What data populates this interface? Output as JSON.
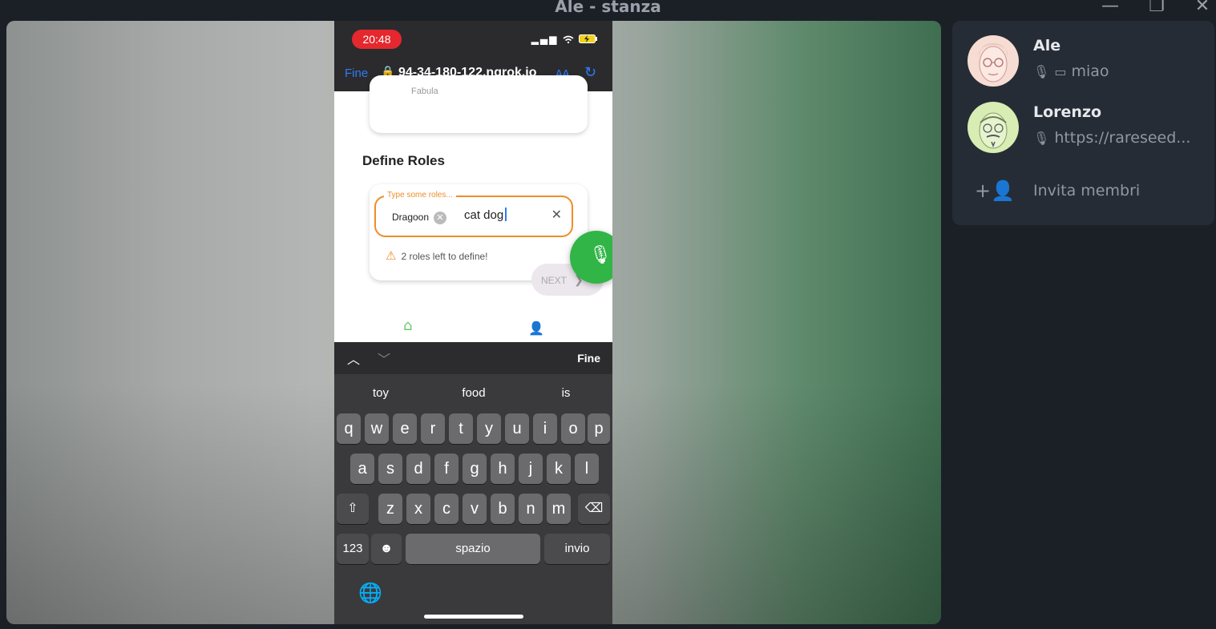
{
  "window": {
    "title": "Ale - stanza",
    "minimize_glyph": "—",
    "restore_glyph": "❐",
    "close_glyph": "✕"
  },
  "phone": {
    "status": {
      "time": "20:48",
      "signal": "▂▄▆",
      "wifi": "wifi-icon",
      "battery": "battery-charging-icon"
    },
    "browser": {
      "done_label": "Fine",
      "url": "94-34-180-122.ngrok.io",
      "text_size_label": "AA",
      "lock_glyph": "🔒",
      "reload_glyph": "↻"
    },
    "page": {
      "top_card_label": "Fabula",
      "section_title": "Define Roles",
      "roles_input_legend": "Type some roles...",
      "chips": [
        {
          "label": "Dragoon",
          "remove_glyph": "✕"
        }
      ],
      "typed_text": "cat dog",
      "clear_glyph": "✕",
      "warning_text": "2 roles left to define!",
      "warning_glyph": "⚠",
      "next_label": "NEXT",
      "next_glyph": "❯",
      "home_glyph": "⌂",
      "person_glyph": "👤",
      "mic_glyph": "🎙"
    },
    "keyboard": {
      "toolbar_up": "︿",
      "toolbar_down": "﹀",
      "toolbar_done": "Fine",
      "suggestions": [
        "toy",
        "food",
        "is"
      ],
      "row1": [
        "q",
        "w",
        "e",
        "r",
        "t",
        "y",
        "u",
        "i",
        "o",
        "p"
      ],
      "row2": [
        "a",
        "s",
        "d",
        "f",
        "g",
        "h",
        "j",
        "k",
        "l"
      ],
      "row3": [
        "z",
        "x",
        "c",
        "v",
        "b",
        "n",
        "m"
      ],
      "shift_glyph": "⇧",
      "delete_glyph": "⌫",
      "numbers_label": "123",
      "emoji_glyph": "☻",
      "space_label": "spazio",
      "return_label": "invio",
      "globe_glyph": "🌐"
    }
  },
  "members": [
    {
      "name": "Ale",
      "mic_glyph": "🎙",
      "screen_glyph": "▭",
      "status": "miao"
    },
    {
      "name": "Lorenzo",
      "mic_glyph": "🎙",
      "status": "https://rareseed..."
    }
  ],
  "invite": {
    "label": "Invita membri",
    "icon_glyph": "+👤"
  }
}
